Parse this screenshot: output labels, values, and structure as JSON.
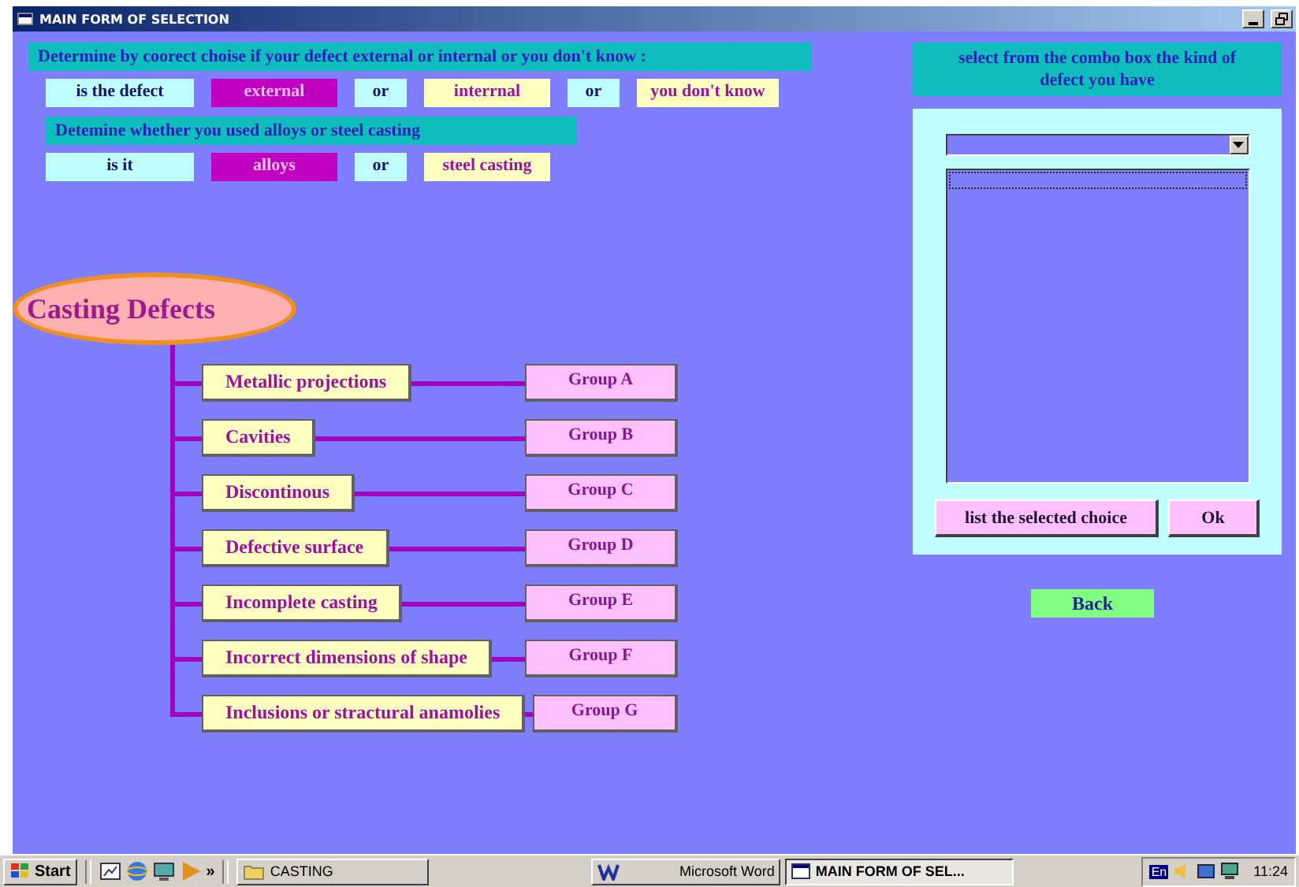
{
  "window": {
    "title": "MAIN FORM OF SELECTION"
  },
  "questions": [
    {
      "heading": "Determine by coorect choise if your defect external or internal or you don't know :",
      "items": [
        {
          "kind": "label",
          "text": "is the defect"
        },
        {
          "kind": "option",
          "text": "external",
          "selected": true
        },
        {
          "kind": "label",
          "text": "or"
        },
        {
          "kind": "option",
          "text": "interrnal",
          "selected": false
        },
        {
          "kind": "label",
          "text": "or"
        },
        {
          "kind": "option",
          "text": "you don't know",
          "selected": false
        }
      ]
    },
    {
      "heading": "Detemine whether you used alloys or steel casting",
      "items": [
        {
          "kind": "label",
          "text": "is it"
        },
        {
          "kind": "option",
          "text": "alloys",
          "selected": true
        },
        {
          "kind": "label",
          "text": "or"
        },
        {
          "kind": "option",
          "text": "steel casting",
          "selected": false
        }
      ]
    }
  ],
  "tree": {
    "root": "Casting Defects",
    "children": [
      {
        "defect": "Metallic projections",
        "group": "Group A"
      },
      {
        "defect": "Cavities",
        "group": "Group B"
      },
      {
        "defect": "Discontinous",
        "group": "Group C"
      },
      {
        "defect": "Defective surface",
        "group": "Group D"
      },
      {
        "defect": "Incomplete casting",
        "group": "Group E"
      },
      {
        "defect": "Incorrect dimensions of shape",
        "group": "Group F"
      },
      {
        "defect": "Inclusions or stractural anamolies",
        "group": "Group G"
      }
    ]
  },
  "selector": {
    "heading": "select from the combo box the kind of defect you have",
    "buttons": [
      "list the selected choice",
      "Ok"
    ]
  },
  "back_button": "Back",
  "taskbar": {
    "start": "Start",
    "chevron": "»",
    "tasks": [
      {
        "label": "CASTING",
        "kind": "folder",
        "selected": false
      },
      {
        "label": "Microsoft Word",
        "kind": "word",
        "selected": false
      },
      {
        "label": "MAIN FORM OF SEL...",
        "kind": "form",
        "selected": true
      }
    ],
    "language": "En",
    "clock": "11:24"
  }
}
